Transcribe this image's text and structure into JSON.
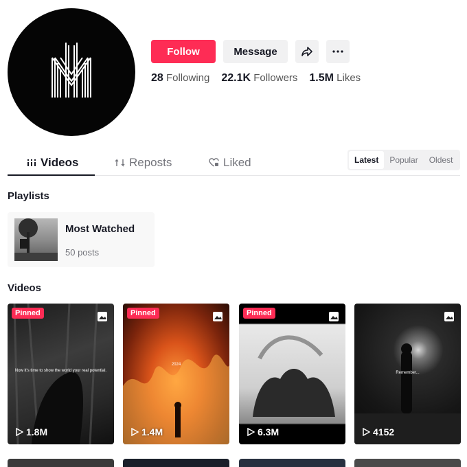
{
  "profile": {
    "follow_label": "Follow",
    "message_label": "Message",
    "stats": [
      {
        "value": "28",
        "label": "Following"
      },
      {
        "value": "22.1K",
        "label": "Followers"
      },
      {
        "value": "1.5M",
        "label": "Likes"
      }
    ]
  },
  "tabs": [
    {
      "label": "Videos",
      "active": true,
      "icon": "grid-icon"
    },
    {
      "label": "Reposts",
      "active": false,
      "icon": "repost-icon"
    },
    {
      "label": "Liked",
      "active": false,
      "icon": "heart-lock-icon"
    }
  ],
  "sort": {
    "options": [
      "Latest",
      "Popular",
      "Oldest"
    ],
    "selected": "Latest"
  },
  "playlists": {
    "heading": "Playlists",
    "items": [
      {
        "title": "Most Watched",
        "posts": "50 posts"
      }
    ]
  },
  "videos": {
    "heading": "Videos",
    "items": [
      {
        "pinned_label": "Pinned",
        "views": "1.8M",
        "caption": "Now it's time to show the world your real potential."
      },
      {
        "pinned_label": "Pinned",
        "views": "1.4M",
        "caption": "2024"
      },
      {
        "pinned_label": "Pinned",
        "views": "6.3M",
        "caption": ""
      },
      {
        "pinned_label": "",
        "views": "4152",
        "caption": "Remember..."
      }
    ]
  },
  "colors": {
    "accent": "#fe2c55",
    "text": "#161823",
    "muted": "#73747b",
    "button_bg": "#f1f1f2"
  }
}
